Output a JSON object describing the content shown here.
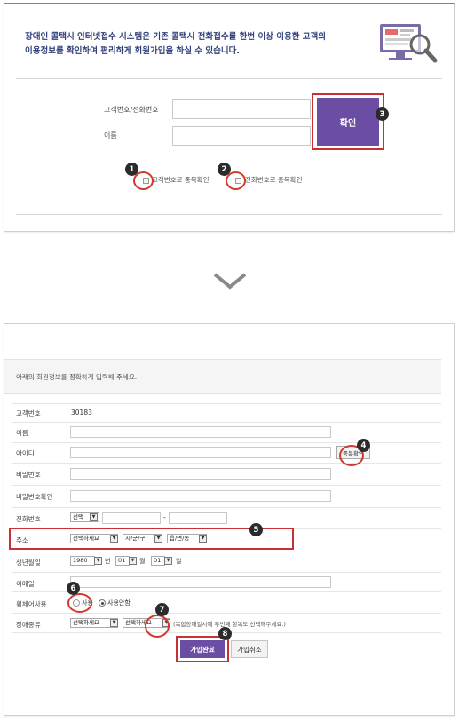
{
  "colors": {
    "accent": "#6b4ea4",
    "highlight": "#c83131",
    "intro_text": "#2f3f7a"
  },
  "step1": {
    "intro_line1": "장애인 콜택시 인터넷접수 시스템은 기존 콜택시 전화접수를 한번 이상 이용한 고객의",
    "intro_line2": "이용정보를 확인하여 편리하게 회원가입을 하실 수 있습니다.",
    "customer_phone_label": "고객번호/전화번호",
    "name_label": "이름",
    "confirm_button": "확인",
    "check_customer_label": "고객번호로 중복확인",
    "check_phone_label": "전화번호로 중복확인"
  },
  "step2": {
    "notice": "아래의 회원정보를 정확하게 입력해 주세요.",
    "customer_number_label": "고객번호",
    "customer_number_value": "30183",
    "name_label": "이름",
    "id_label": "아이디",
    "dup_check_button": "중복확인",
    "password_label": "비밀번호",
    "password_confirm_label": "비밀번호확인",
    "phone_label": "전화번호",
    "phone_select": "선택",
    "phone_dash": "-",
    "address_label": "주소",
    "address_select1": "선택하세요",
    "address_select2": "시/군/구",
    "address_select3": "읍/면/동",
    "birth_label": "생년월일",
    "birth_year": "1980",
    "birth_year_unit": "년",
    "birth_month": "01",
    "birth_month_unit": "월",
    "birth_day": "01",
    "birth_day_unit": "일",
    "email_label": "이메일",
    "wheelchair_label": "휠체어사용",
    "wheelchair_opt1": "사용",
    "wheelchair_opt2": "사용안함",
    "disability_label": "장애종류",
    "disability_select1": "선택하세요",
    "disability_select2": "선택하세요",
    "disability_note": "(복합장애일시에 두번째 항목도 선택해주세요.)",
    "join_button": "가입완료",
    "cancel_button": "가입취소"
  },
  "badges": [
    "1",
    "2",
    "3",
    "4",
    "5",
    "6",
    "7",
    "8"
  ]
}
